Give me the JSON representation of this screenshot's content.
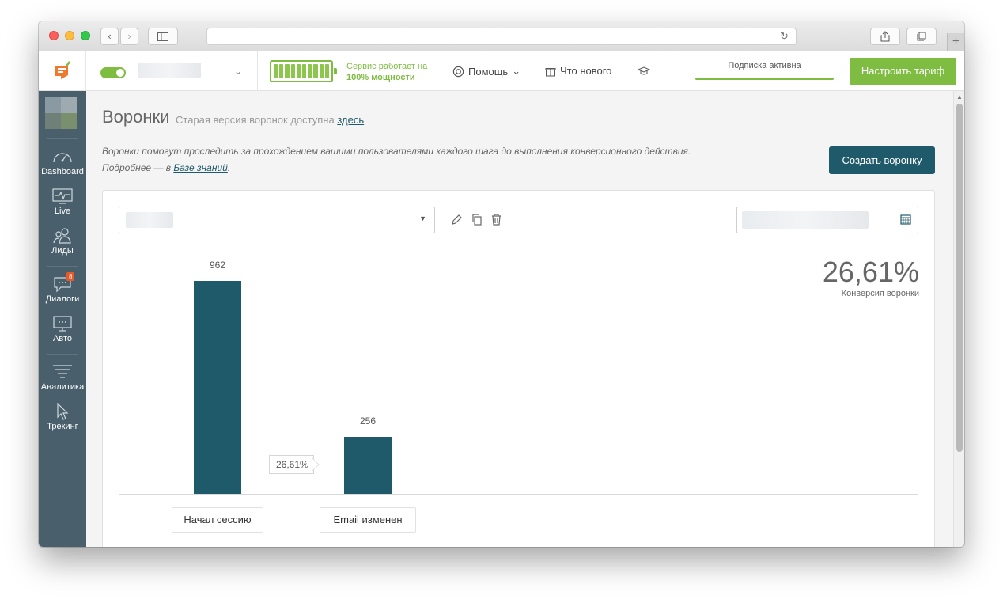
{
  "header": {
    "service_status_line1": "Сервис работает на",
    "service_status_line2": "100% мощности",
    "help_label": "Помощь",
    "whats_new_label": "Что нового",
    "subscription_label": "Подписка активна",
    "tariff_button": "Настроить тариф",
    "accent_color": "#7fbc42"
  },
  "sidebar": {
    "items": [
      {
        "label": "Dashboard",
        "icon": "speedometer-icon"
      },
      {
        "label": "Live",
        "icon": "monitor-pulse-icon"
      },
      {
        "label": "Лиды",
        "icon": "users-icon"
      },
      {
        "label": "Диалоги",
        "icon": "chat-icon",
        "badge": "8"
      },
      {
        "label": "Авто",
        "icon": "auto-message-icon"
      },
      {
        "label": "Аналитика",
        "icon": "funnel-lines-icon"
      },
      {
        "label": "Трекинг",
        "icon": "cursor-icon"
      }
    ],
    "bg_color": "#495f6b"
  },
  "page": {
    "title": "Воронки",
    "subtitle_prefix": "Старая версия воронок доступна",
    "subtitle_link": "здесь",
    "description_line1": "Воронки помогут проследить за прохождением вашими пользователями каждого шага до выполнения конверсионного действия.",
    "description_line2_prefix": "Подробнее — в",
    "description_link": "Базе знаний",
    "description_line2_suffix": ".",
    "create_button": "Создать воронку",
    "primary_color": "#1f5a6b"
  },
  "funnel": {
    "conversion_value": "26,61%",
    "conversion_label": "Конверсия воронки",
    "step_conversion": "26,61%",
    "steps": [
      {
        "label": "Начал сессию",
        "value": 962
      },
      {
        "label": "Email изменен",
        "value": 256
      }
    ]
  },
  "chart_data": {
    "type": "bar",
    "categories": [
      "Начал сессию",
      "Email изменен"
    ],
    "values": [
      962,
      256
    ],
    "ylim": [
      0,
      962
    ]
  }
}
